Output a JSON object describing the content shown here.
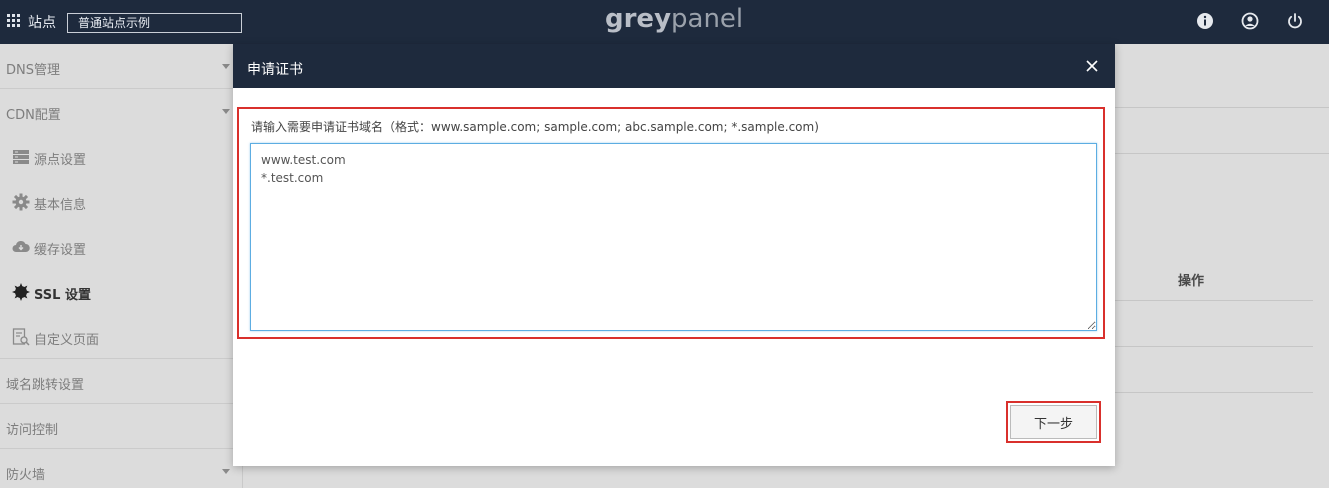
{
  "topbar": {
    "site_label": "站点",
    "site_select_value": "普通站点示例",
    "logo_part1": "grey",
    "logo_part2": "panel"
  },
  "sidebar": {
    "items": [
      {
        "label": "DNS管理",
        "icon": "",
        "active": false
      },
      {
        "label": "CDN配置",
        "icon": "",
        "active": false
      },
      {
        "label": "源点设置",
        "icon": "server-icon",
        "active": false
      },
      {
        "label": "基本信息",
        "icon": "gear-icon",
        "active": false
      },
      {
        "label": "缓存设置",
        "icon": "cloud-download-icon",
        "active": false
      },
      {
        "label": "SSL 设置",
        "icon": "badge-gear-icon",
        "active": true
      },
      {
        "label": "自定义页面",
        "icon": "page-search-icon",
        "active": false
      },
      {
        "label": "域名跳转设置",
        "icon": "",
        "active": false
      },
      {
        "label": "访问控制",
        "icon": "",
        "active": false
      },
      {
        "label": "防火墙",
        "icon": "",
        "active": false
      }
    ]
  },
  "background": {
    "operation_header": "操作"
  },
  "modal": {
    "title": "申请证书",
    "label": "请输入需要申请证书域名（格式：www.sample.com; sample.com; abc.sample.com; *.sample.com)",
    "textarea_value": "www.test.com\n*.test.com",
    "next_button": "下一步"
  },
  "colors": {
    "navy": "#1e2a3d",
    "highlight_red": "#d9302c",
    "focus_blue": "#5dade2"
  }
}
